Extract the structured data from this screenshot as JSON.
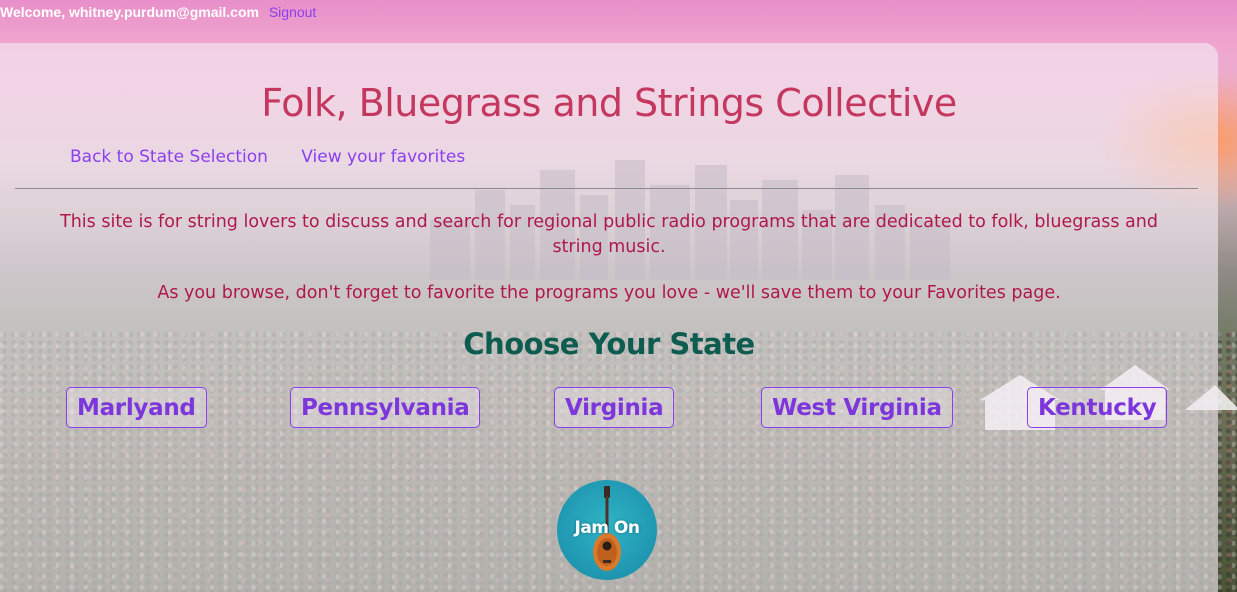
{
  "header": {
    "welcome_text": "Welcome, whitney.purdum@gmail.com",
    "signout_label": "Signout"
  },
  "site": {
    "title": "Folk, Bluegrass and Strings Collective"
  },
  "nav": {
    "back_label": "Back to State Selection",
    "favorites_label": "View your favorites"
  },
  "intro": {
    "paragraph_1": "This site is for string lovers to discuss and search for regional public radio programs that are dedicated to folk, bluegrass and string music.",
    "paragraph_2": "As you browse, don't forget to favorite the programs you love - we'll save them to your Favorites page."
  },
  "states": {
    "heading": "Choose Your State",
    "items": [
      {
        "label": "Marlyand"
      },
      {
        "label": "Pennsylvania"
      },
      {
        "label": "Virginia"
      },
      {
        "label": "West Virginia"
      },
      {
        "label": "Kentucky"
      }
    ]
  },
  "logo": {
    "text": "Jam On",
    "icon": "mandolin-icon"
  },
  "colors": {
    "title": "#c5375f",
    "link": "#8a3ff0",
    "body_text": "#b0184a",
    "heading": "#0d5c4f",
    "logo_bg": "#1f96b0"
  }
}
